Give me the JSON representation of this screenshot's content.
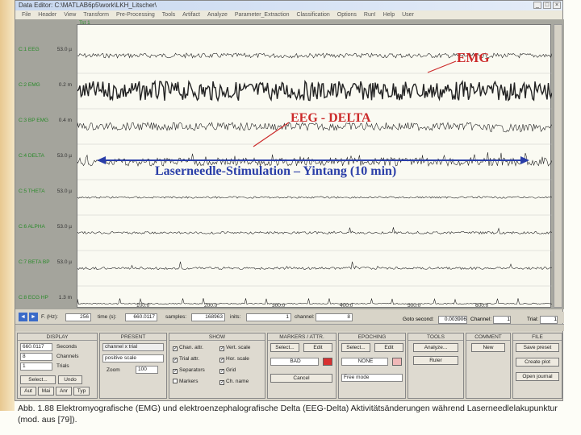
{
  "window": {
    "title": "Data Editor: C:\\MATLAB6p5\\work\\LKH_Litscher\\"
  },
  "menu": [
    "File",
    "Header",
    "View",
    "Transform",
    "Pre-Processing",
    "Tools",
    "Artifact",
    "Analyze",
    "Parameter_Extraction",
    "Classification",
    "Options",
    "Run!",
    "Help",
    "User"
  ],
  "plot": {
    "corner_label": "Tst 1",
    "channels": [
      {
        "name": "C:1 EEG",
        "unit": "53.0 µ"
      },
      {
        "name": "C:2 EMG",
        "unit": "0.2 m"
      },
      {
        "name": "C:3 BP EMG",
        "unit": "0.4 m"
      },
      {
        "name": "C:4 DELTA",
        "unit": "53.0 µ"
      },
      {
        "name": "C:5 THETA",
        "unit": "53.0 µ"
      },
      {
        "name": "C:6 ALPHA",
        "unit": "53.0 µ"
      },
      {
        "name": "C:7 BETA BP",
        "unit": "53.0 µ"
      },
      {
        "name": "C:8 ECG HP",
        "unit": "1.3 m"
      }
    ],
    "x_ticks": [
      "100.0",
      "200.0",
      "300.0",
      "400.0",
      "500.0",
      "600.0"
    ],
    "annotations": {
      "emg": "EMG",
      "delta": "EEG - DELTA",
      "stimulation": "Laserneedle-Stimulation – Yintang (10 min)"
    }
  },
  "nav": {
    "fs_label": "F. (Hz):",
    "fs": "256",
    "time_label": "time (s):",
    "time": "660.0117",
    "samples_label": "samples:",
    "samples": "168963",
    "inits_label": "inits:",
    "inits": "1",
    "channel_label": "channel:",
    "channel": "8",
    "goto_label": "Goto second:",
    "goto": "0.003906",
    "channel2_label": "Channel:",
    "channel2": "1",
    "trial_label": "Trial:",
    "trial": "1"
  },
  "display": {
    "header": "DISPLAY",
    "seconds": "660.0117",
    "seconds_label": "Seconds",
    "channels": "8",
    "channels_label": "Channels",
    "trials": "1",
    "trials_label": "Trials",
    "select": "Select...",
    "undo": "Undo",
    "btn_au": "Aut",
    "btn_ma": "Mai",
    "btn_an": "Anr",
    "btn_typ": "Typ"
  },
  "present": {
    "header": "PRESENT",
    "mode": "channel x trial",
    "scale": "positive scale",
    "zoom_label": "Zoom",
    "zoom": "100"
  },
  "show": {
    "header": "SHOW",
    "items": [
      "Chan. attr.",
      "Trial attr.",
      "Separators",
      "Markers",
      "Vert. scale",
      "Hor. scale",
      "Grid",
      "Ch. name"
    ],
    "checked": [
      true,
      true,
      true,
      false,
      true,
      true,
      true,
      true
    ]
  },
  "markers": {
    "header": "MARKERS / ATTR.",
    "select": "Select...",
    "edit": "Edit",
    "bad": "BAD",
    "cancel": "Cancel"
  },
  "epoching": {
    "header": "EPOCHING",
    "select": "Select...",
    "edit": "Edit",
    "none": "NONE",
    "mode": "Free mode"
  },
  "tools": {
    "header": "TOOLS",
    "analyze": "Analyze...",
    "ruler": "Ruler"
  },
  "comment": {
    "header": "COMMENT",
    "new": "New"
  },
  "file": {
    "header": "FILE",
    "save_preset": "Save preset",
    "create_plot": "Create plot",
    "open_journal": "Open journal"
  },
  "caption": "Abb. 1.88 Elektromyografische (EMG) und elektroenzephalografische Delta (EEG-Delta) Aktivitätsänderungen während Laserneedlelakupunktur (mod. aus [79]).",
  "colors": {
    "channel_label": "#2a8a2a",
    "annotation_red": "#cc2a2a",
    "annotation_blue": "#2a3ea8"
  }
}
